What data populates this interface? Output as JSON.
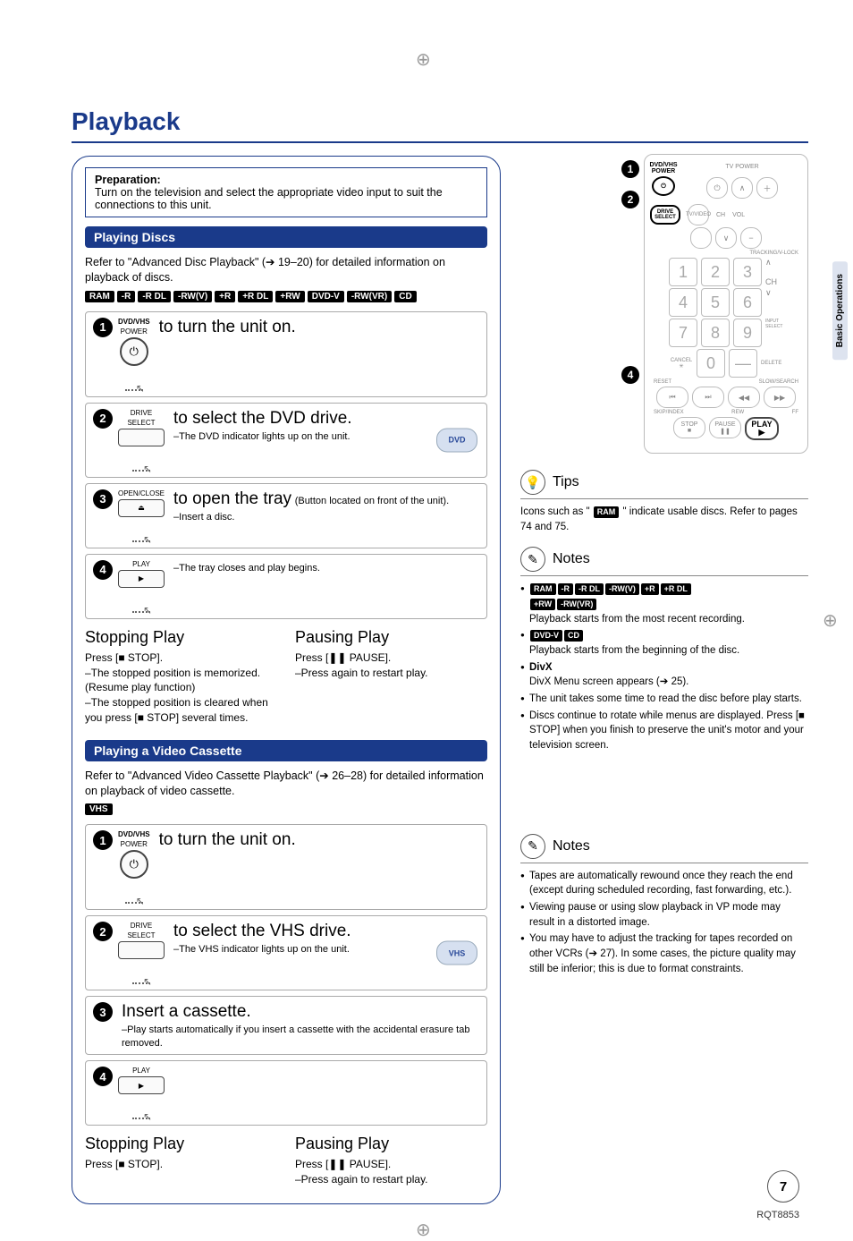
{
  "title": "Playback",
  "sideTab": "Basic Operations",
  "preparation": {
    "heading": "Preparation:",
    "text": "Turn on the television and select the appropriate video input to suit the connections to this unit."
  },
  "playingDiscs": {
    "bar": "Playing Discs",
    "intro_pre": "Refer to \"Advanced Disc Playback\" (",
    "intro_ref": "➔ 19–20",
    "intro_post": ") for detailed information on playback of discs.",
    "tags": [
      "RAM",
      "-R",
      "-R DL",
      "-RW(V)",
      "+R",
      "+R DL",
      "+RW",
      "DVD-V",
      "-RW(VR)",
      "CD"
    ],
    "steps": [
      {
        "n": "1",
        "iconTop": "DVD/VHS",
        "iconSub": "POWER",
        "iconSym": "⏻",
        "text": "to turn the unit on."
      },
      {
        "n": "2",
        "iconTop": "DRIVE",
        "iconSub": "SELECT",
        "text": "to select the DVD drive.",
        "note": "–The DVD indicator lights up on the unit.",
        "ind": "DVD"
      },
      {
        "n": "3",
        "iconTop": "OPEN/CLOSE",
        "iconSym": "⏏",
        "text": "to open the tray",
        "tail": "(Button located on front of the unit).",
        "note": "–Insert a disc."
      },
      {
        "n": "4",
        "iconTop": "PLAY",
        "iconSym": "▶",
        "note": "–The tray closes and play begins."
      }
    ],
    "stopping": {
      "head": "Stopping Play",
      "l1": "Press [■ STOP].",
      "l2": "–The stopped position is memorized. (Resume play function)",
      "l3": "–The stopped position is cleared when you press [■ STOP] several times."
    },
    "pausing": {
      "head": "Pausing Play",
      "l1": "Press [❚❚ PAUSE].",
      "l2": "–Press again to restart play."
    }
  },
  "playingVhs": {
    "bar": "Playing a Video Cassette",
    "intro_pre": "Refer to \"Advanced Video Cassette Playback\" (",
    "intro_ref": "➔ 26–28",
    "intro_post": ") for detailed information on playback of video cassette.",
    "tag": "VHS",
    "steps": [
      {
        "n": "1",
        "iconTop": "DVD/VHS",
        "iconSub": "POWER",
        "iconSym": "⏻",
        "text": "to turn the unit on."
      },
      {
        "n": "2",
        "iconTop": "DRIVE",
        "iconSub": "SELECT",
        "text": "to select the VHS drive.",
        "note": "–The VHS indicator lights up on the unit.",
        "ind": "VHS"
      },
      {
        "n": "3",
        "text": "Insert a cassette.",
        "note": "–Play starts automatically if you insert a cassette with the accidental erasure tab removed."
      },
      {
        "n": "4",
        "iconTop": "PLAY",
        "iconSym": "▶"
      }
    ],
    "stopping": {
      "head": "Stopping Play",
      "l1": "Press [■ STOP]."
    },
    "pausing": {
      "head": "Pausing Play",
      "l1": "Press [❚❚ PAUSE].",
      "l2": "–Press again to restart play."
    }
  },
  "remote": {
    "callouts": [
      "1",
      "2",
      "4"
    ],
    "power": {
      "l1": "DVD/VHS",
      "l2": "POWER"
    },
    "drive": {
      "l1": "DRIVE",
      "l2": "SELECT"
    },
    "tvpower": "TV POWER",
    "tvvideo": "TV/VIDEO",
    "ch": "CH",
    "vol": "VOL",
    "digits": [
      "1",
      "2",
      "3",
      "4",
      "5",
      "6",
      "7",
      "8",
      "9",
      "0"
    ],
    "cancel": "CANCEL",
    "reset": "RESET",
    "delete": "DELETE",
    "inputsel": "INPUT SELECT",
    "tracking": "TRACKING/V-LOCK",
    "slow": "SLOW/SEARCH",
    "skip": "SKIP/INDEX",
    "rew": "REW",
    "ff": "FF",
    "stop": "STOP",
    "pause": "PAUSE",
    "play": "PLAY"
  },
  "tips": {
    "head": "Tips",
    "pre": "Icons such as \" ",
    "tag": "RAM",
    "post": " \" indicate usable discs. Refer to pages 74 and 75."
  },
  "notes1": {
    "head": "Notes",
    "row1_tags": [
      "RAM",
      "-R",
      "-R DL",
      "-RW(V)",
      "+R",
      "+R DL",
      "+RW",
      "-RW(VR)"
    ],
    "row1_text": "Playback starts from the most recent recording.",
    "row2_tags": [
      "DVD-V",
      "CD"
    ],
    "row2_text": "Playback starts from the beginning of the disc.",
    "divx_head": "DivX",
    "divx_text": "DivX Menu screen appears (➔ 25).",
    "li3": "The unit takes some time to read the disc before play starts.",
    "li4": "Discs continue to rotate while menus are displayed. Press [■ STOP] when you finish to preserve the unit's motor and your television screen."
  },
  "notes2": {
    "head": "Notes",
    "li1": "Tapes are automatically rewound once they reach the end (except during scheduled recording, fast forwarding, etc.).",
    "li2": "Viewing pause or using slow playback in VP mode may result in a distorted image.",
    "li3": "You may have to adjust the tracking for tapes recorded on other VCRs (➔ 27). In some cases, the picture quality may still be inferior; this is due to format constraints."
  },
  "pageNum": "7",
  "footer": "RQT8853"
}
